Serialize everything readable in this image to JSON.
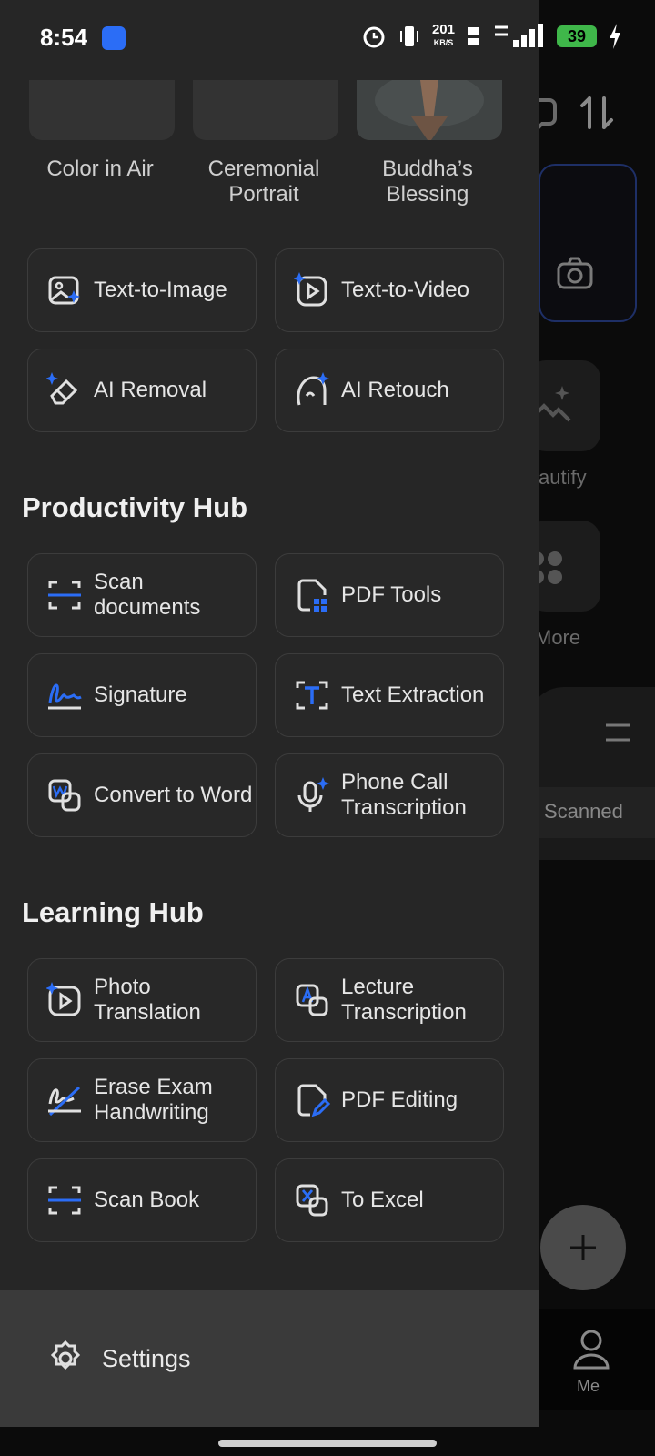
{
  "status_bar": {
    "time": "8:54",
    "net_speed": "201",
    "net_unit": "KB/S",
    "battery": "39"
  },
  "gallery": [
    {
      "label": "Color in Air"
    },
    {
      "label": "Ceremonial\nPortrait"
    },
    {
      "label": "Buddha’s\nBlessing"
    }
  ],
  "ai_tools": [
    {
      "label": "Text-to-Image",
      "icon": "image-sparkle-icon"
    },
    {
      "label": "Text-to-Video",
      "icon": "video-sparkle-icon"
    },
    {
      "label": "AI Removal",
      "icon": "eraser-icon"
    },
    {
      "label": "AI Retouch",
      "icon": "retouch-face-icon"
    }
  ],
  "productivity": {
    "title": "Productivity Hub",
    "items": [
      {
        "label": "Scan\ndocuments",
        "icon": "scan-icon"
      },
      {
        "label": "PDF Tools",
        "icon": "pdf-tools-icon"
      },
      {
        "label": "Signature",
        "icon": "signature-icon"
      },
      {
        "label": "Text Extraction",
        "icon": "text-extract-icon"
      },
      {
        "label": "Convert to Word",
        "icon": "word-convert-icon"
      },
      {
        "label": "Phone Call\nTranscription",
        "icon": "mic-sparkle-icon"
      }
    ]
  },
  "learning": {
    "title": "Learning Hub",
    "items": [
      {
        "label": "Photo\nTranslation",
        "icon": "photo-translate-icon"
      },
      {
        "label": "Lecture\nTranscription",
        "icon": "lecture-icon"
      },
      {
        "label": "Erase Exam\nHandwriting",
        "icon": "erase-handwriting-icon"
      },
      {
        "label": "PDF Editing",
        "icon": "pdf-edit-icon"
      },
      {
        "label": "Scan Book",
        "icon": "scan-book-icon"
      },
      {
        "label": "To Excel",
        "icon": "excel-icon"
      }
    ]
  },
  "settings": {
    "label": "Settings"
  },
  "background_app": {
    "beautify": "autify",
    "more": "More",
    "scanned": "Scanned",
    "me": "Me"
  },
  "colors": {
    "accent": "#2b6df6",
    "drawer": "#262626",
    "battery": "#3fb74a"
  }
}
